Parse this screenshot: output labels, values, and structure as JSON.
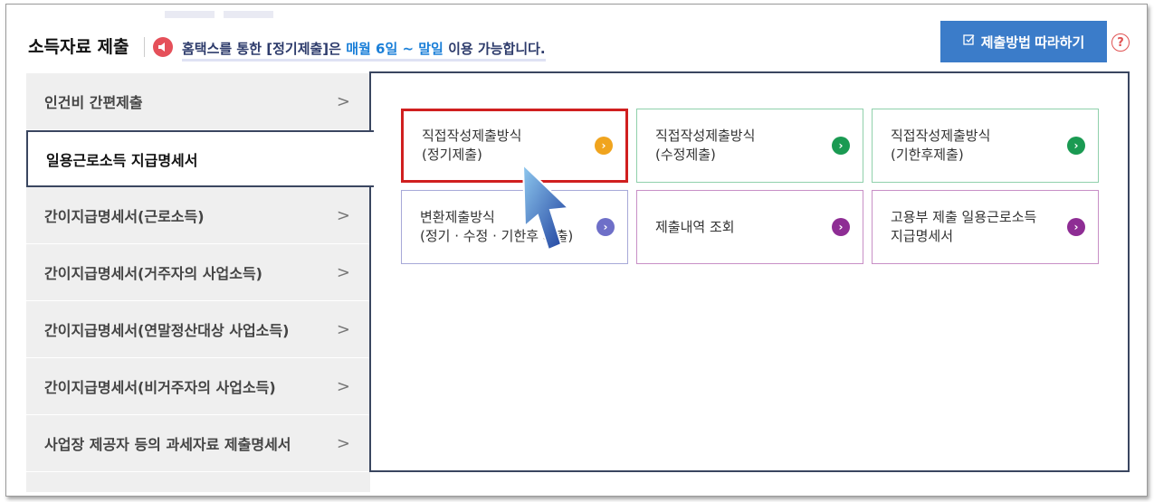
{
  "header": {
    "title": "소득자료 제출",
    "notice_prefix": "홈택스를 통한 [정기제출]은 ",
    "notice_highlight": "매월 6일 ~ 말일",
    "notice_suffix": " 이용 가능합니다.",
    "guide_button": "제출방법 따라하기",
    "help_label": "?"
  },
  "sidebar": {
    "items": [
      {
        "label": "인건비 간편제출",
        "chevron": ">"
      },
      {
        "label": "일용근로소득 지급명세서",
        "chevron": ""
      },
      {
        "label": "간이지급명세서(근로소득)",
        "chevron": ">"
      },
      {
        "label": "간이지급명세서(거주자의 사업소득)",
        "chevron": ">"
      },
      {
        "label": "간이지급명세서(연말정산대상 사업소득)",
        "chevron": ">"
      },
      {
        "label": "간이지급명세서(비거주자의 사업소득)",
        "chevron": ">"
      },
      {
        "label": "사업장 제공자 등의 과세자료 제출명세서",
        "chevron": ">"
      }
    ],
    "active_index": 1
  },
  "cards": [
    {
      "line1": "직접작성제출방식",
      "line2": "(정기제출)",
      "arrow_color": "#f0a41e"
    },
    {
      "line1": "직접작성제출방식",
      "line2": "(수정제출)",
      "arrow_color": "#1a9a52"
    },
    {
      "line1": "직접작성제출방식",
      "line2": "(기한후제출)",
      "arrow_color": "#1a9a52"
    },
    {
      "line1": "변환제출방식",
      "line2": "(정기 · 수정 · 기한후 제출)",
      "arrow_color": "#6e6fc8"
    },
    {
      "line1": "제출내역 조회",
      "line2": "",
      "arrow_color": "#8e2d94"
    },
    {
      "line1": "고용부 제출 일용근로소득",
      "line2": "지급명세서",
      "arrow_color": "#8e2d94"
    }
  ],
  "icons": {
    "notice": "speaker-icon",
    "guide": "checkbox-edit-icon",
    "card_arrow": "chevron-right-circle-icon",
    "cursor": "pointer-cursor-icon"
  },
  "colors": {
    "accent": "#3b7cc9",
    "highlight_border": "#d01f1f",
    "notice_highlight": "#1a7fd8"
  }
}
